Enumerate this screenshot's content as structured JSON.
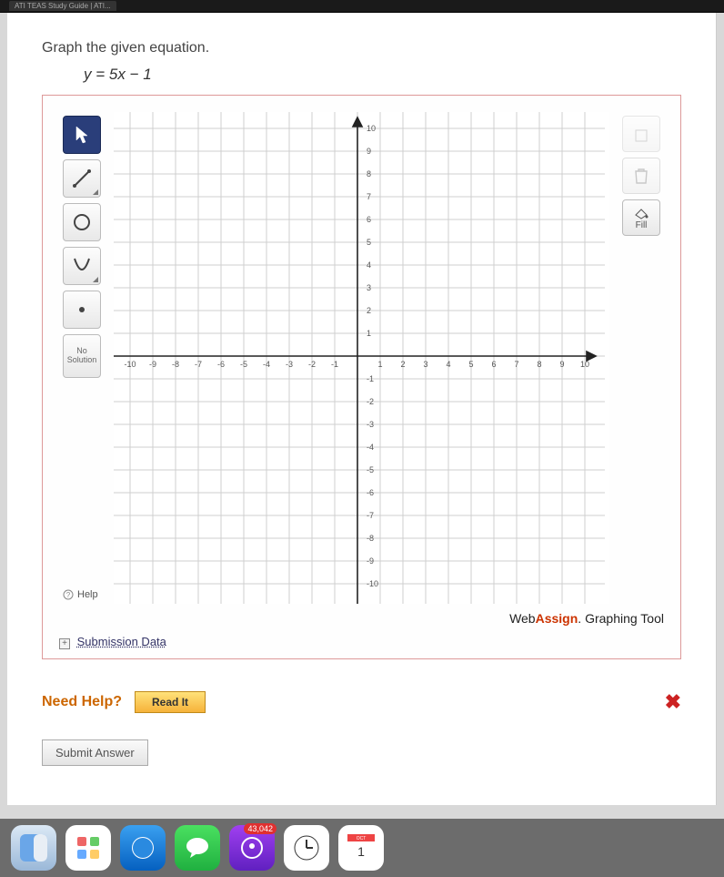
{
  "browser": {
    "tab1": "ATI TEAS Study Guide | ATI..."
  },
  "question": {
    "prompt": "Graph the given equation.",
    "equation": "y = 5x − 1"
  },
  "tools": {
    "left": [
      {
        "name": "select-tool",
        "label": "pointer",
        "selected": true
      },
      {
        "name": "line-tool",
        "label": "line"
      },
      {
        "name": "circle-tool",
        "label": "circle"
      },
      {
        "name": "parabola-tool",
        "label": "parabola"
      },
      {
        "name": "point-tool",
        "label": "point"
      },
      {
        "name": "no-solution-tool",
        "label_line1": "No",
        "label_line2": "Solution"
      }
    ],
    "right": {
      "fill_label": "Fill"
    },
    "help_label": "Help"
  },
  "chart_data": {
    "type": "scatter",
    "title": "",
    "xlabel": "",
    "ylabel": "",
    "xlim": [
      -10,
      10
    ],
    "ylim": [
      -10,
      10
    ],
    "x_ticks": [
      -10,
      -9,
      -8,
      -7,
      -6,
      -5,
      -4,
      -3,
      -2,
      -1,
      1,
      2,
      3,
      4,
      5,
      6,
      7,
      8,
      9,
      10
    ],
    "y_ticks": [
      -10,
      -9,
      -8,
      -7,
      -6,
      -5,
      -4,
      -3,
      -2,
      -1,
      1,
      2,
      3,
      4,
      5,
      6,
      7,
      8,
      9,
      10
    ],
    "series": []
  },
  "branding": {
    "web": "Web",
    "assign": "Assign",
    "suffix": ". Graphing Tool"
  },
  "submission": {
    "link_label": "Submission Data",
    "expand_glyph": "+"
  },
  "help": {
    "need_help": "Need Help?",
    "read_it": "Read It"
  },
  "status": {
    "marker": "✖"
  },
  "submit": {
    "label": "Submit Answer"
  },
  "dock": {
    "badge": "43,042"
  }
}
